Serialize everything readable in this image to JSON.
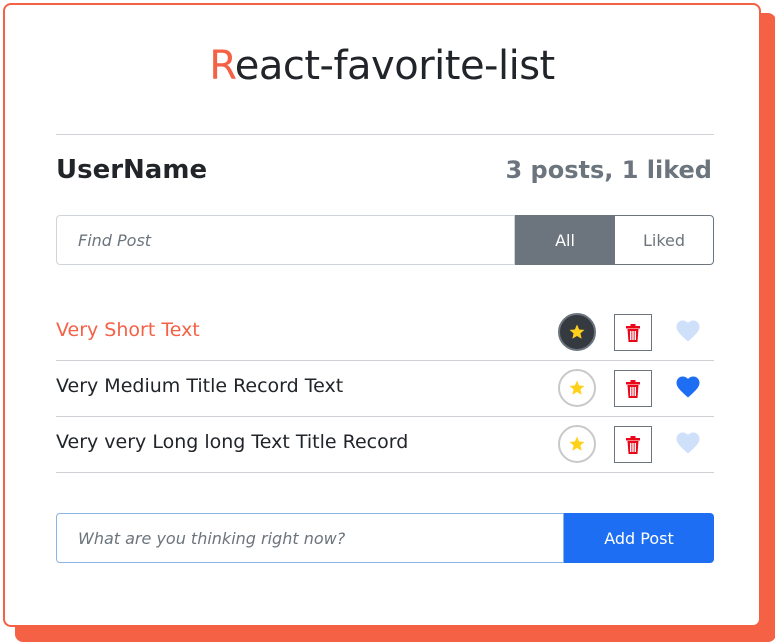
{
  "app": {
    "title_first": "R",
    "title_rest": "eact-favorite-list"
  },
  "header": {
    "username": "UserName",
    "stats": "3 posts, 1 liked"
  },
  "search": {
    "placeholder": "Find Post"
  },
  "filters": [
    {
      "label": "All",
      "active": true
    },
    {
      "label": "Liked",
      "active": false
    }
  ],
  "posts": [
    {
      "text": "Very Short Text",
      "important": true,
      "liked": false
    },
    {
      "text": "Very Medium Title Record Text",
      "important": false,
      "liked": true
    },
    {
      "text": "Very very Long long Text Title Record",
      "important": false,
      "liked": false
    }
  ],
  "add_form": {
    "placeholder": "What are you thinking right now?",
    "button_label": "Add Post"
  },
  "icons": {
    "star": "star-icon",
    "trash": "trash-icon",
    "heart": "heart-icon"
  },
  "colors": {
    "accent": "#f46145",
    "primary": "#1e6ef4",
    "secondary": "#6c757d",
    "star": "#ffd11a",
    "trash": "#e8081a",
    "heart_liked": "#1e6ef4",
    "heart_unliked": "#cfe0fb"
  }
}
